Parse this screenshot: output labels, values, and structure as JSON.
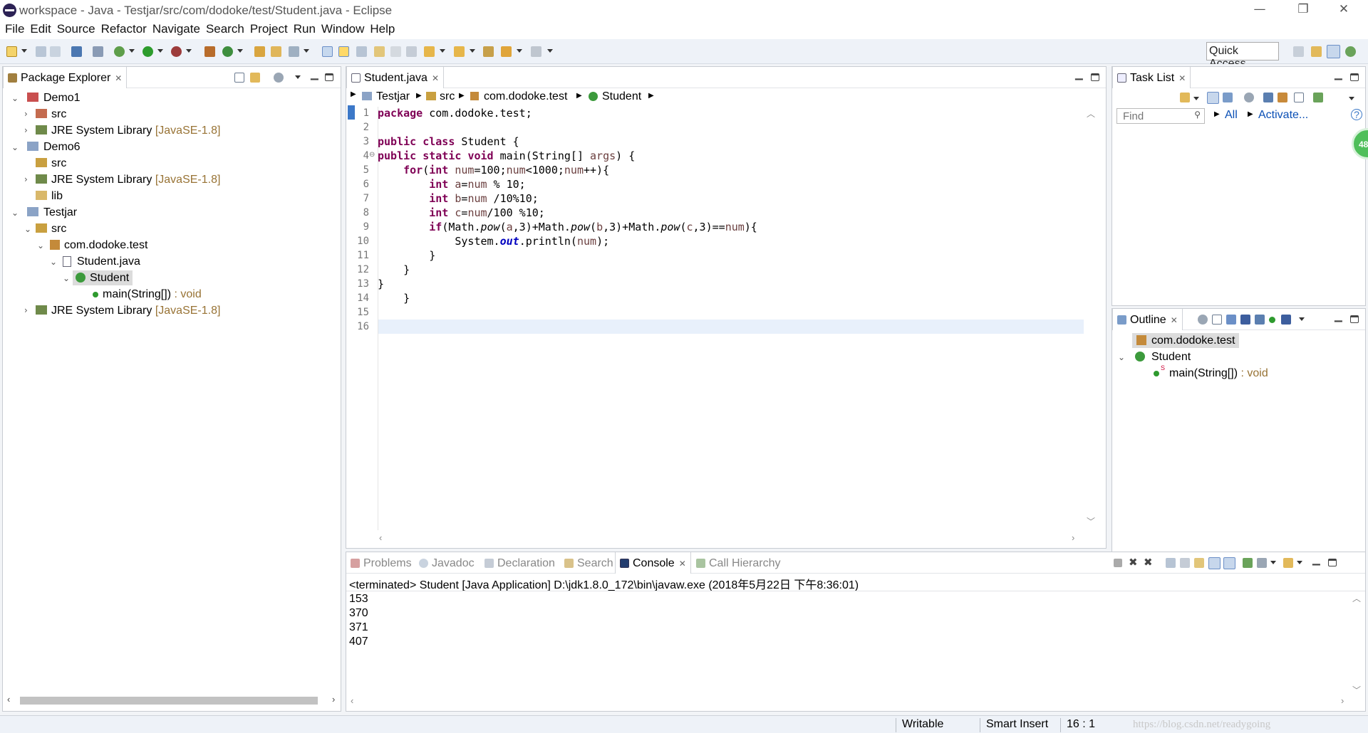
{
  "window": {
    "title": "workspace - Java - Testjar/src/com/dodoke/test/Student.java - Eclipse",
    "minimize": "—",
    "restore": "❐",
    "close": "✕"
  },
  "menu": [
    "File",
    "Edit",
    "Source",
    "Refactor",
    "Navigate",
    "Search",
    "Project",
    "Run",
    "Window",
    "Help"
  ],
  "toolbar": {
    "quick_access": "Quick Access"
  },
  "package_explorer": {
    "title": "Package Explorer",
    "tree": [
      {
        "label": "Demo1"
      },
      {
        "label": "src"
      },
      {
        "label": "JRE System Library",
        "suffix": "[JavaSE-1.8]"
      },
      {
        "label": "Demo6"
      },
      {
        "label": "src"
      },
      {
        "label": "JRE System Library",
        "suffix": "[JavaSE-1.8]"
      },
      {
        "label": "lib"
      },
      {
        "label": "Testjar"
      },
      {
        "label": "src"
      },
      {
        "label": "com.dodoke.test"
      },
      {
        "label": "Student.java"
      },
      {
        "label": "Student"
      },
      {
        "label": "main(String[])",
        "suffix": ": void"
      },
      {
        "label": "JRE System Library",
        "suffix": "[JavaSE-1.8]"
      }
    ]
  },
  "editor": {
    "tab": "Student.java",
    "breadcrumb": [
      "Testjar",
      "src",
      "com.dodoke.test",
      "Student"
    ],
    "line_numbers": [
      "1",
      "2",
      "3",
      "4",
      "5",
      "6",
      "7",
      "8",
      "9",
      "10",
      "11",
      "12",
      "13",
      "14",
      "15",
      "16"
    ],
    "lines": [
      "package com.dodoke.test;",
      "",
      "public class Student {",
      "public static void main(String[] args) {",
      "    for(int num=100;num<1000;num++){",
      "        int a=num % 10;",
      "        int b=num /10%10;",
      "        int c=num/100 %10;",
      "        if(Math.pow(a,3)+Math.pow(b,3)+Math.pow(c,3)==num){",
      "            System.out.println(num);",
      "        }",
      "    }",
      "}",
      "    }",
      "",
      ""
    ]
  },
  "task_list": {
    "title": "Task List",
    "find_placeholder": "Find",
    "all": "All",
    "activate": "Activate...",
    "badge": "48"
  },
  "outline": {
    "title": "Outline",
    "items": [
      {
        "label": "com.dodoke.test"
      },
      {
        "label": "Student"
      },
      {
        "label": "main(String[])",
        "suffix": ": void"
      }
    ]
  },
  "bottom": {
    "tabs": [
      "Problems",
      "Javadoc",
      "Declaration",
      "Search",
      "Console",
      "Call Hierarchy"
    ],
    "console_header": "<terminated> Student [Java Application] D:\\jdk1.8.0_172\\bin\\javaw.exe (2018年5月22日 下午8:36:01)",
    "console_lines": [
      "153",
      "370",
      "371",
      "407"
    ]
  },
  "status": {
    "writable": "Writable",
    "insert_mode": "Smart Insert",
    "position": "16 : 1",
    "watermark": "https://blog.csdn.net/readygoing"
  },
  "colors": {
    "keyword": "#7f0055",
    "variable": "#6a3e3e",
    "static_field": "#0000c0",
    "library_suffix": "#987335",
    "link": "#0a4fb5"
  }
}
